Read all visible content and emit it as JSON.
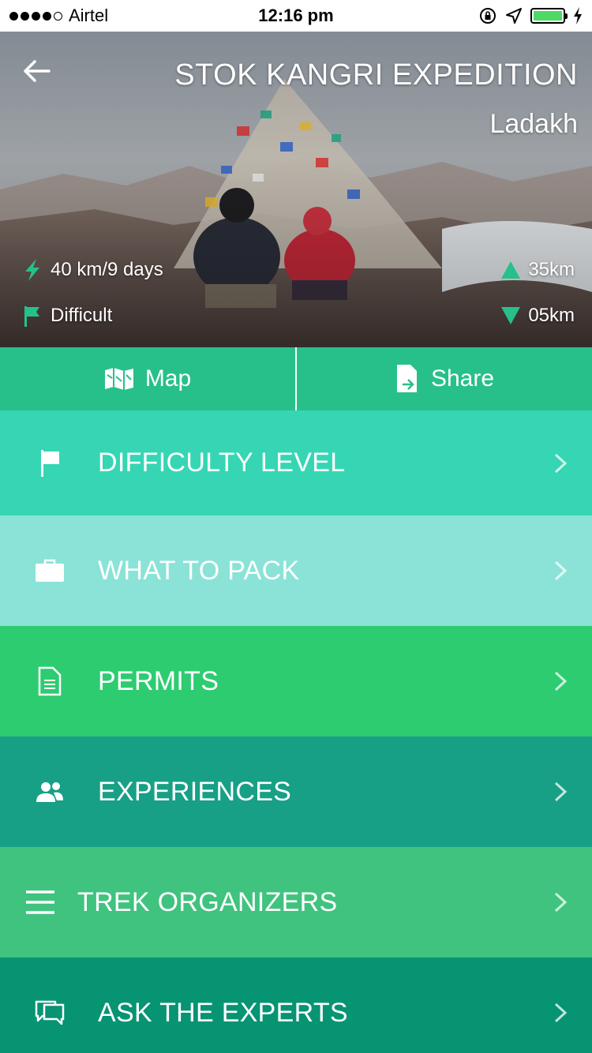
{
  "status_bar": {
    "carrier": "Airtel",
    "time": "12:16 pm",
    "battery_color": "#4cd964"
  },
  "hero": {
    "title": "STOK KANGRI EXPEDITION",
    "subtitle": "Ladakh",
    "distance_duration": "40 km/9 days",
    "difficulty": "Difficult",
    "ascent": "35km",
    "descent": "05km",
    "accent_color": "#27c08a"
  },
  "actions": [
    {
      "label": "Map",
      "icon": "map-icon"
    },
    {
      "label": "Share",
      "icon": "share-icon"
    }
  ],
  "menu": [
    {
      "label": "DIFFICULTY LEVEL",
      "icon": "flag-icon",
      "color": "#36d6b4"
    },
    {
      "label": "WHAT TO PACK",
      "icon": "briefcase-icon",
      "color": "#8ae3d6"
    },
    {
      "label": "PERMITS",
      "icon": "document-icon",
      "color": "#2ecc71"
    },
    {
      "label": "EXPERIENCES",
      "icon": "people-icon",
      "color": "#17a086"
    },
    {
      "label": "TREK ORGANIZERS",
      "icon": "menu-icon",
      "color": "#40c37f"
    },
    {
      "label": "ASK THE EXPERTS",
      "icon": "chat-icon",
      "color": "#069473"
    }
  ]
}
